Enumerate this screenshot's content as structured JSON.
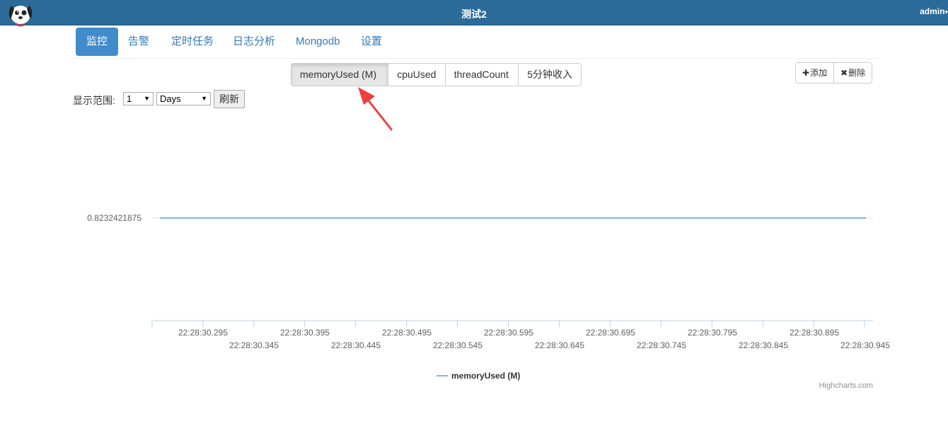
{
  "header": {
    "title": "测试2",
    "user": "admin",
    "caret": "▾",
    "logo_icon": "dog-mascot-logo"
  },
  "nav": {
    "items": [
      {
        "label": "监控",
        "active": true
      },
      {
        "label": "告警"
      },
      {
        "label": "定时任务"
      },
      {
        "label": "日志分析"
      },
      {
        "label": "Mongodb"
      },
      {
        "label": "设置"
      }
    ]
  },
  "metrics": {
    "buttons": [
      {
        "label": "memoryUsed (M)",
        "active": true
      },
      {
        "label": "cpuUsed"
      },
      {
        "label": "threadCount"
      },
      {
        "label": "5分钟收入"
      }
    ]
  },
  "actions": {
    "add_icon": "✚",
    "add_label": "添加",
    "delete_icon": "✖",
    "delete_label": "删除"
  },
  "range": {
    "label": "显示范围:",
    "amount": "1",
    "unit": "Days",
    "refresh_label": "刷新"
  },
  "chart_data": {
    "type": "line",
    "title": "",
    "xlabel": "",
    "ylabel": "",
    "y_ticks": [
      "0.8232421875"
    ],
    "x_ticks_row1": [
      "22:28:30.295",
      "22:28:30.395",
      "22:28:30.495",
      "22:28:30.595",
      "22:28:30.695",
      "22:28:30.795",
      "22:28:30.895"
    ],
    "x_ticks_row2": [
      "22:28:30.345",
      "22:28:30.445",
      "22:28:30.545",
      "22:28:30.645",
      "22:28:30.745",
      "22:28:30.845",
      "22:28:30.945"
    ],
    "series": [
      {
        "name": "memoryUsed (M)",
        "color": "#7cb5ec",
        "value": 0.8232421875
      }
    ],
    "credits": "Highcharts.com",
    "legend_position": "bottom-center"
  },
  "colors": {
    "header_bg": "#2c6a99",
    "accent": "#428bca",
    "annotation_arrow": "#f03e3e"
  }
}
